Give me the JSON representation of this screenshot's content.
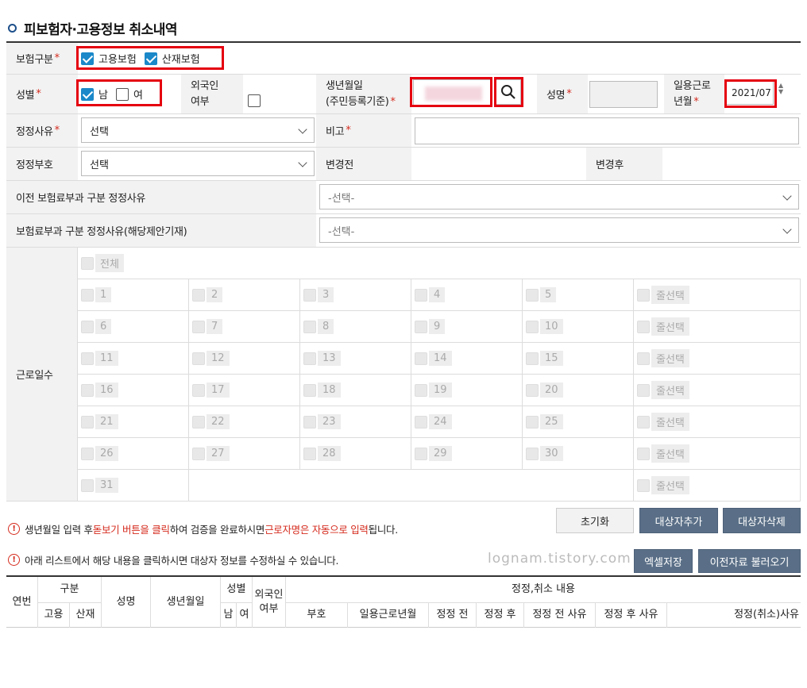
{
  "title": "피보험자·고용정보 취소내역",
  "insurance_type": {
    "label": "보험구분",
    "employment": {
      "label": "고용보험",
      "checked": true
    },
    "industrial": {
      "label": "산재보험",
      "checked": true
    }
  },
  "gender": {
    "label": "성별",
    "male": {
      "label": "남",
      "checked": true
    },
    "female": {
      "label": "여",
      "checked": false
    }
  },
  "foreigner": {
    "label_line1": "외국인",
    "label_line2": "여부",
    "checked": false
  },
  "birth": {
    "label_line1": "생년월일",
    "label_line2": "(주민등록기준)",
    "value": ""
  },
  "name": {
    "label": "성명",
    "value": ""
  },
  "work_month": {
    "label_line1": "일용근로",
    "label_line2": "년월",
    "value": "2021/07"
  },
  "correction_reason": {
    "label": "정정사유",
    "value": "선택"
  },
  "remarks": {
    "label": "비고",
    "value": ""
  },
  "correction_code": {
    "label": "정정부호",
    "value": "선택"
  },
  "before_change": {
    "label": "변경전",
    "value": ""
  },
  "after_change": {
    "label": "변경후",
    "value": ""
  },
  "prev_reason": {
    "label": "이전 보험료부과 구분 정정사유",
    "value": "-선택-"
  },
  "insurance_reason": {
    "label": "보험료부과 구분 정정사유(해당제안기재)",
    "value": "-선택-"
  },
  "workdays": {
    "label": "근로일수",
    "all_label": "전체",
    "row_select_label": "줄선택",
    "days": [
      "1",
      "2",
      "3",
      "4",
      "5",
      "6",
      "7",
      "8",
      "9",
      "10",
      "11",
      "12",
      "13",
      "14",
      "15",
      "16",
      "17",
      "18",
      "19",
      "20",
      "21",
      "22",
      "23",
      "24",
      "25",
      "26",
      "27",
      "28",
      "29",
      "30",
      "31"
    ]
  },
  "buttons": {
    "reset": "초기화",
    "add_target": "대상자추가",
    "delete_target": "대상자삭제",
    "excel_save": "엑셀저장",
    "load_previous": "이전자료 불러오기"
  },
  "notices": {
    "n1_a": "생년월일 입력 후 ",
    "n1_b": "돋보기 버튼을 클릭",
    "n1_c": "하여 검증을 완료하시면 ",
    "n1_d": "근로자명은 자동으로 입력",
    "n1_e": "됩니다.",
    "n2": "아래 리스트에서 해당 내용을 클릭하시면 대상자 정보를 수정하실 수 있습니다."
  },
  "watermark": "lognam.tistory.com",
  "list_header": {
    "seq": "연번",
    "category": "구분",
    "employment": "고용",
    "industrial": "산재",
    "name": "성명",
    "birth": "생년월일",
    "gender": "성별",
    "male": "남",
    "female": "여",
    "foreigner_line1": "외국인",
    "foreigner_line2": "여부",
    "correction_group": "정정,취소 내용",
    "code": "부호",
    "work_month": "일용근로년월",
    "before": "정정 전",
    "after": "정정 후",
    "before_reason": "정정 전 사유",
    "after_reason": "정정 후 사유",
    "cancel_reason": "정정(취소)사유"
  },
  "colors": {
    "accent": "#1a88c9",
    "required": "#d52b1e",
    "button_dark": "#5a6f87",
    "highlight_box": "#e5000f"
  }
}
